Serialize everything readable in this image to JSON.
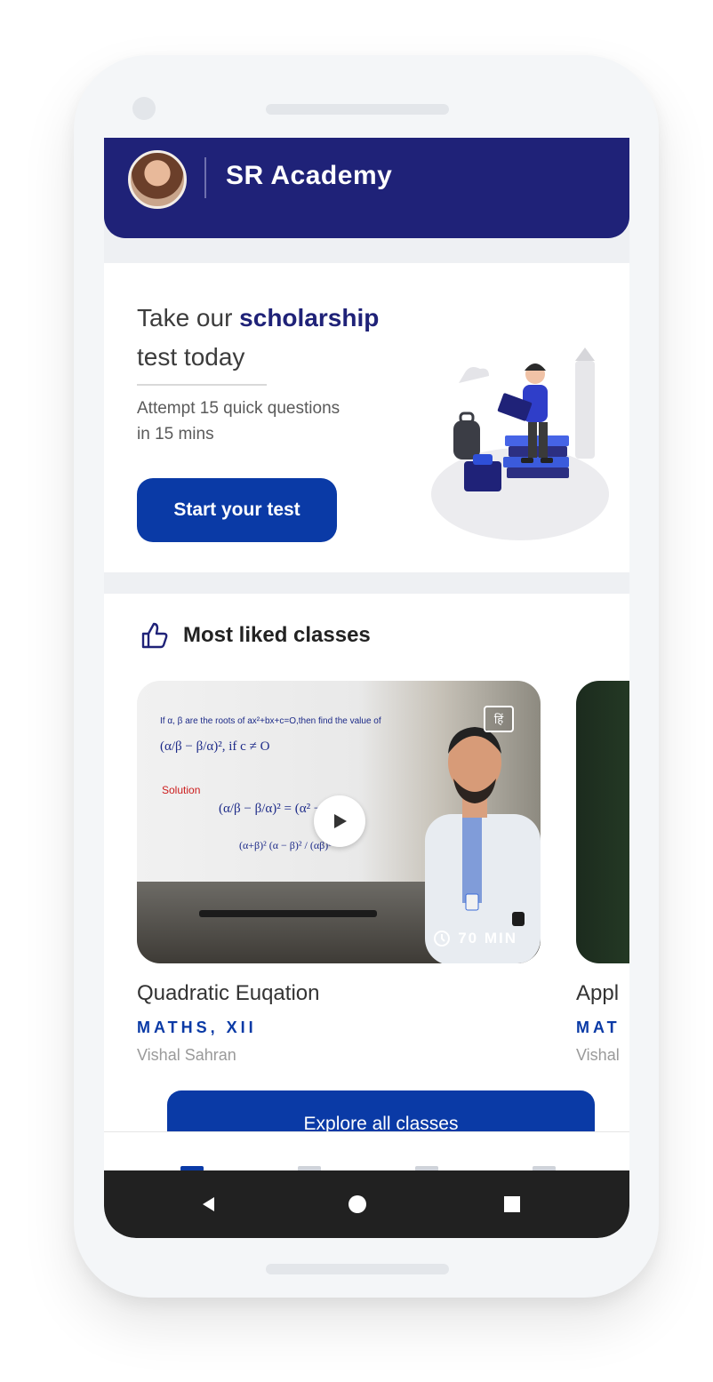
{
  "header": {
    "app_title": "SR Academy"
  },
  "promo": {
    "heading_prefix": "Take our ",
    "heading_highlight": "scholarship",
    "heading_suffix": "test today",
    "subtitle_line1": "Attempt 15 quick questions",
    "subtitle_line2": "in 15 mins",
    "cta_label": "Start your test"
  },
  "most_liked": {
    "section_title": "Most liked classes",
    "classes": [
      {
        "title": "Quadratic Euqation",
        "subject": "MATHS, XII",
        "teacher": "Vishal Sahran",
        "duration": "70 MIN",
        "lang_badge": "हिं",
        "board_question": "If α, β are the roots of ax²+bx+c=O,then find the value of",
        "board_expression": "(α/β − β/α)²,  if c ≠ O",
        "board_solution_label": "Solution",
        "board_step1": "(α/β − β/α)² = (α² − β²/αβ)",
        "board_step2": "(α+β)² (α − β)² / (αβ)²"
      },
      {
        "title": "Appl",
        "subject": "MAT",
        "teacher": "Vishal"
      }
    ],
    "explore_label": "Explore all classes"
  },
  "system_nav": {
    "back_icon": "back-triangle-icon",
    "home_icon": "home-circle-icon",
    "recents_icon": "recents-square-icon"
  },
  "colors": {
    "header_bg": "#1f2278",
    "primary": "#0a3aa6",
    "system_nav_bg": "#212121"
  }
}
